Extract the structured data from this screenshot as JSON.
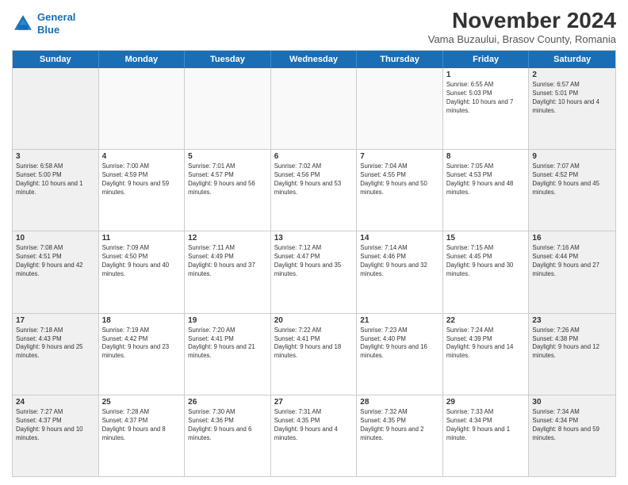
{
  "logo": {
    "line1": "General",
    "line2": "Blue"
  },
  "title": "November 2024",
  "subtitle": "Vama Buzaului, Brasov County, Romania",
  "header_days": [
    "Sunday",
    "Monday",
    "Tuesday",
    "Wednesday",
    "Thursday",
    "Friday",
    "Saturday"
  ],
  "rows": [
    [
      {
        "day": "",
        "detail": ""
      },
      {
        "day": "",
        "detail": ""
      },
      {
        "day": "",
        "detail": ""
      },
      {
        "day": "",
        "detail": ""
      },
      {
        "day": "",
        "detail": ""
      },
      {
        "day": "1",
        "detail": "Sunrise: 6:55 AM\nSunset: 5:03 PM\nDaylight: 10 hours and 7 minutes."
      },
      {
        "day": "2",
        "detail": "Sunrise: 6:57 AM\nSunset: 5:01 PM\nDaylight: 10 hours and 4 minutes."
      }
    ],
    [
      {
        "day": "3",
        "detail": "Sunrise: 6:58 AM\nSunset: 5:00 PM\nDaylight: 10 hours and 1 minute."
      },
      {
        "day": "4",
        "detail": "Sunrise: 7:00 AM\nSunset: 4:59 PM\nDaylight: 9 hours and 59 minutes."
      },
      {
        "day": "5",
        "detail": "Sunrise: 7:01 AM\nSunset: 4:57 PM\nDaylight: 9 hours and 56 minutes."
      },
      {
        "day": "6",
        "detail": "Sunrise: 7:02 AM\nSunset: 4:56 PM\nDaylight: 9 hours and 53 minutes."
      },
      {
        "day": "7",
        "detail": "Sunrise: 7:04 AM\nSunset: 4:55 PM\nDaylight: 9 hours and 50 minutes."
      },
      {
        "day": "8",
        "detail": "Sunrise: 7:05 AM\nSunset: 4:53 PM\nDaylight: 9 hours and 48 minutes."
      },
      {
        "day": "9",
        "detail": "Sunrise: 7:07 AM\nSunset: 4:52 PM\nDaylight: 9 hours and 45 minutes."
      }
    ],
    [
      {
        "day": "10",
        "detail": "Sunrise: 7:08 AM\nSunset: 4:51 PM\nDaylight: 9 hours and 42 minutes."
      },
      {
        "day": "11",
        "detail": "Sunrise: 7:09 AM\nSunset: 4:50 PM\nDaylight: 9 hours and 40 minutes."
      },
      {
        "day": "12",
        "detail": "Sunrise: 7:11 AM\nSunset: 4:49 PM\nDaylight: 9 hours and 37 minutes."
      },
      {
        "day": "13",
        "detail": "Sunrise: 7:12 AM\nSunset: 4:47 PM\nDaylight: 9 hours and 35 minutes."
      },
      {
        "day": "14",
        "detail": "Sunrise: 7:14 AM\nSunset: 4:46 PM\nDaylight: 9 hours and 32 minutes."
      },
      {
        "day": "15",
        "detail": "Sunrise: 7:15 AM\nSunset: 4:45 PM\nDaylight: 9 hours and 30 minutes."
      },
      {
        "day": "16",
        "detail": "Sunrise: 7:16 AM\nSunset: 4:44 PM\nDaylight: 9 hours and 27 minutes."
      }
    ],
    [
      {
        "day": "17",
        "detail": "Sunrise: 7:18 AM\nSunset: 4:43 PM\nDaylight: 9 hours and 25 minutes."
      },
      {
        "day": "18",
        "detail": "Sunrise: 7:19 AM\nSunset: 4:42 PM\nDaylight: 9 hours and 23 minutes."
      },
      {
        "day": "19",
        "detail": "Sunrise: 7:20 AM\nSunset: 4:41 PM\nDaylight: 9 hours and 21 minutes."
      },
      {
        "day": "20",
        "detail": "Sunrise: 7:22 AM\nSunset: 4:41 PM\nDaylight: 9 hours and 18 minutes."
      },
      {
        "day": "21",
        "detail": "Sunrise: 7:23 AM\nSunset: 4:40 PM\nDaylight: 9 hours and 16 minutes."
      },
      {
        "day": "22",
        "detail": "Sunrise: 7:24 AM\nSunset: 4:39 PM\nDaylight: 9 hours and 14 minutes."
      },
      {
        "day": "23",
        "detail": "Sunrise: 7:26 AM\nSunset: 4:38 PM\nDaylight: 9 hours and 12 minutes."
      }
    ],
    [
      {
        "day": "24",
        "detail": "Sunrise: 7:27 AM\nSunset: 4:37 PM\nDaylight: 9 hours and 10 minutes."
      },
      {
        "day": "25",
        "detail": "Sunrise: 7:28 AM\nSunset: 4:37 PM\nDaylight: 9 hours and 8 minutes."
      },
      {
        "day": "26",
        "detail": "Sunrise: 7:30 AM\nSunset: 4:36 PM\nDaylight: 9 hours and 6 minutes."
      },
      {
        "day": "27",
        "detail": "Sunrise: 7:31 AM\nSunset: 4:35 PM\nDaylight: 9 hours and 4 minutes."
      },
      {
        "day": "28",
        "detail": "Sunrise: 7:32 AM\nSunset: 4:35 PM\nDaylight: 9 hours and 2 minutes."
      },
      {
        "day": "29",
        "detail": "Sunrise: 7:33 AM\nSunset: 4:34 PM\nDaylight: 9 hours and 1 minute."
      },
      {
        "day": "30",
        "detail": "Sunrise: 7:34 AM\nSunset: 4:34 PM\nDaylight: 8 hours and 59 minutes."
      }
    ]
  ]
}
